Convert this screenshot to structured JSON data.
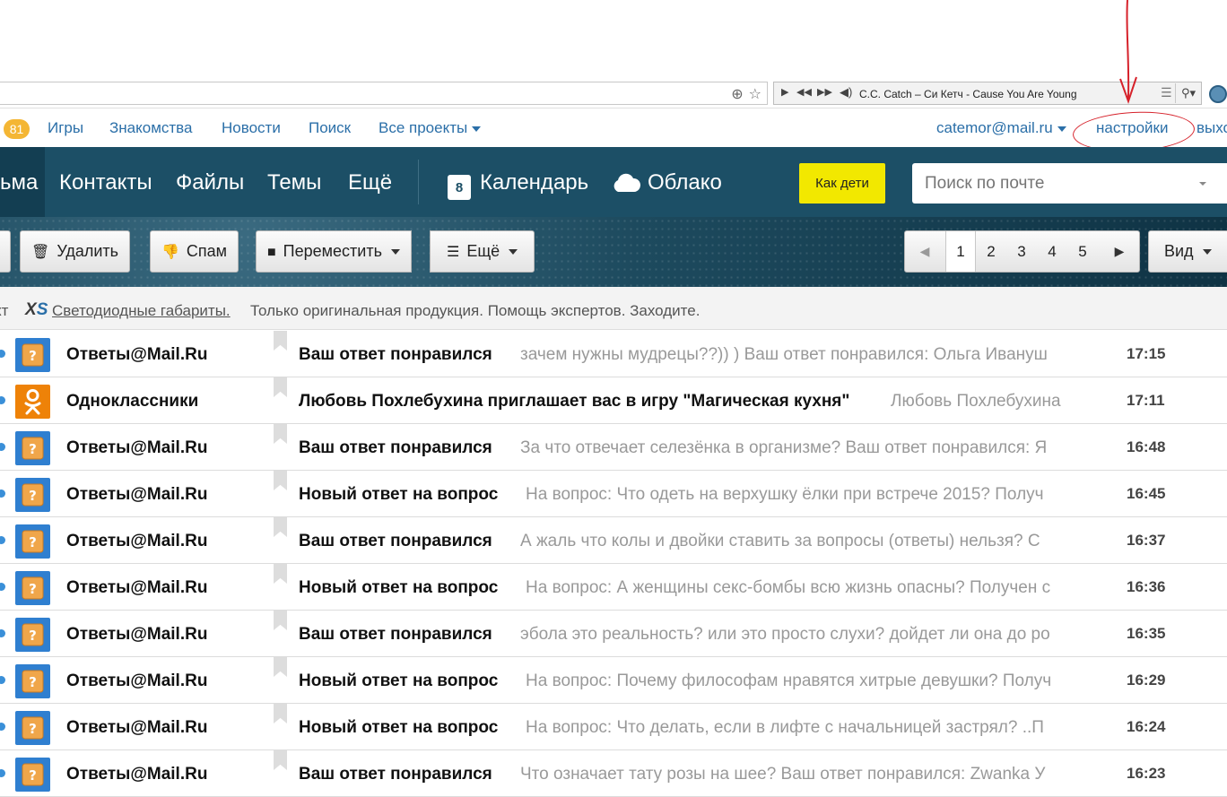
{
  "browser": {
    "player_track": "C.C. Catch – Си Кетч - Cause You Are Young"
  },
  "portal": {
    "badge": "81",
    "links": [
      "Игры",
      "Знакомства",
      "Новости",
      "Поиск",
      "Все проекты"
    ],
    "user": "catemor@mail.ru",
    "settings": "настройки",
    "logout": "выхо"
  },
  "nav": {
    "active_tab": "ьма",
    "items": [
      "Контакты",
      "Файлы",
      "Темы",
      "Ещё"
    ],
    "calendar": "Календарь",
    "calendar_day": "8",
    "cloud": "Облако",
    "kids_button": "Как дети",
    "search_placeholder": "Поиск по почте"
  },
  "toolbar": {
    "delete": "Удалить",
    "spam": "Спам",
    "move": "Переместить",
    "more": "Ещё",
    "pages": [
      "1",
      "2",
      "3",
      "4",
      "5"
    ],
    "current_page": "1",
    "view": "Вид"
  },
  "ad": {
    "cut": "кт",
    "brand_x": "X",
    "brand_s": "S",
    "link": "Светодиодные габариты.",
    "text": "Только оригинальная продукция. Помощь экспертов. Заходите."
  },
  "messages": [
    {
      "sender": "Ответы@Mail.Ru",
      "subject": "Ваш ответ понравился",
      "snippet": "зачем нужны мудрецы??)) ) Ваш ответ понравился: Ольга Ивануш",
      "time": "17:15",
      "avatar": "answers"
    },
    {
      "sender": "Одноклассники",
      "subject": "Любовь Похлебухина приглашает вас в игру \"Магическая кухня\"",
      "snippet": "Любовь Похлебухина",
      "time": "17:11",
      "avatar": "ok"
    },
    {
      "sender": "Ответы@Mail.Ru",
      "subject": "Ваш ответ понравился",
      "snippet": "За что отвечает селезёнка в организме? Ваш ответ понравился: Я",
      "time": "16:48",
      "avatar": "answers"
    },
    {
      "sender": "Ответы@Mail.Ru",
      "subject": "Новый ответ на вопрос",
      "snippet": "На вопрос: Что одеть на верхушку ёлки при встрече 2015? Получ",
      "time": "16:45",
      "avatar": "answers"
    },
    {
      "sender": "Ответы@Mail.Ru",
      "subject": "Ваш ответ понравился",
      "snippet": "А жаль что колы и двойки ставить за вопросы (ответы) нельзя? С",
      "time": "16:37",
      "avatar": "answers"
    },
    {
      "sender": "Ответы@Mail.Ru",
      "subject": "Новый ответ на вопрос",
      "snippet": "На вопрос: А женщины секс-бомбы всю жизнь опасны? Получен с",
      "time": "16:36",
      "avatar": "answers"
    },
    {
      "sender": "Ответы@Mail.Ru",
      "subject": "Ваш ответ понравился",
      "snippet": "эбола это реальность? или это просто слухи? дойдет ли она до ро",
      "time": "16:35",
      "avatar": "answers"
    },
    {
      "sender": "Ответы@Mail.Ru",
      "subject": "Новый ответ на вопрос",
      "snippet": "На вопрос: Почему философам нравятся хитрые девушки? Получ",
      "time": "16:29",
      "avatar": "answers"
    },
    {
      "sender": "Ответы@Mail.Ru",
      "subject": "Новый ответ на вопрос",
      "snippet": "На вопрос: Что делать, если в лифте с начальницей застрял? ..П",
      "time": "16:24",
      "avatar": "answers"
    },
    {
      "sender": "Ответы@Mail.Ru",
      "subject": "Ваш ответ понравился",
      "snippet": "Что означает тату розы на шее? Ваш ответ понравился: Zwanka У",
      "time": "16:23",
      "avatar": "answers"
    }
  ],
  "colors": {
    "nav_bg": "#1c4f66",
    "link": "#2b6fa8",
    "kids_button": "#f2e800",
    "badge": "#f4b634",
    "annotation": "#d6212a"
  }
}
